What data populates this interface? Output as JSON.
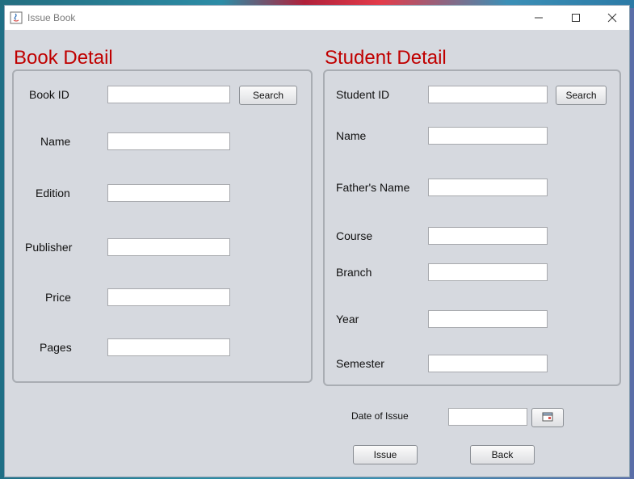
{
  "window": {
    "title": "Issue Book"
  },
  "book": {
    "title": "Book Detail",
    "search_label": "Search",
    "fields": [
      {
        "label": "Book ID",
        "value": ""
      },
      {
        "label": "Name",
        "value": ""
      },
      {
        "label": "Edition",
        "value": ""
      },
      {
        "label": "Publisher",
        "value": ""
      },
      {
        "label": "Price",
        "value": ""
      },
      {
        "label": "Pages",
        "value": ""
      }
    ]
  },
  "student": {
    "title": "Student Detail",
    "search_label": "Search",
    "fields": [
      {
        "label": "Student ID",
        "value": ""
      },
      {
        "label": "Name",
        "value": ""
      },
      {
        "label": "Father's Name",
        "value": ""
      },
      {
        "label": "Course",
        "value": ""
      },
      {
        "label": "Branch",
        "value": ""
      },
      {
        "label": "Year",
        "value": ""
      },
      {
        "label": "Semester",
        "value": ""
      }
    ]
  },
  "issue": {
    "date_label": "Date of Issue",
    "date_value": "",
    "calendar_icon": "calendar-icon",
    "issue_label": "Issue",
    "back_label": "Back"
  },
  "colors": {
    "accent": "#c00000",
    "window_bg": "#d6d9df"
  }
}
